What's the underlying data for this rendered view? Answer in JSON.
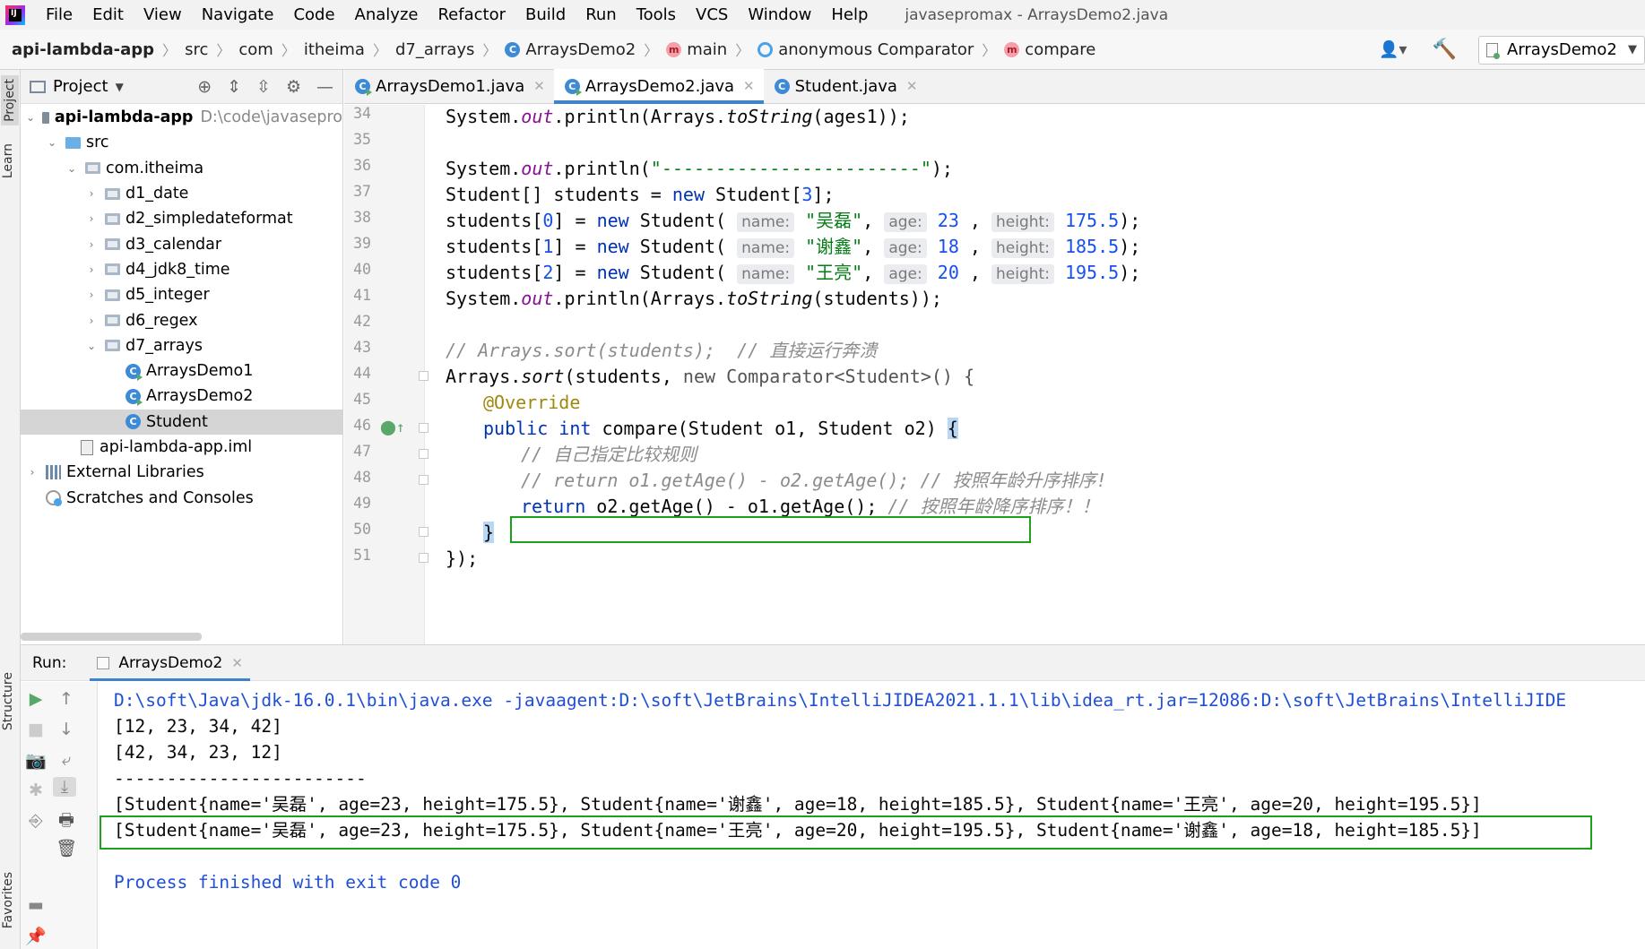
{
  "menubar": {
    "items": [
      "File",
      "Edit",
      "View",
      "Navigate",
      "Code",
      "Analyze",
      "Refactor",
      "Build",
      "Run",
      "Tools",
      "VCS",
      "Window",
      "Help"
    ],
    "window_title": "javasepromax - ArraysDemo2.java",
    "logo_text": "IJ"
  },
  "breadcrumb": {
    "project": "api-lambda-app",
    "src": "src",
    "com": "com",
    "itheima": "itheima",
    "pkg": "d7_arrays",
    "class": "ArraysDemo2",
    "method": "main",
    "anon": "anonymous Comparator",
    "compare": "compare"
  },
  "run_config": "ArraysDemo2",
  "side_tabs": {
    "project": "Project",
    "learn": "Learn",
    "structure": "Structure",
    "favorites": "Favorites"
  },
  "project_panel": {
    "title": "Project",
    "tree": [
      {
        "label": "api-lambda-app",
        "path": "D:\\code\\javasepro"
      },
      {
        "label": "src"
      },
      {
        "label": "com.itheima"
      },
      {
        "label": "d1_date"
      },
      {
        "label": "d2_simpledateformat"
      },
      {
        "label": "d3_calendar"
      },
      {
        "label": "d4_jdk8_time"
      },
      {
        "label": "d5_integer"
      },
      {
        "label": "d6_regex"
      },
      {
        "label": "d7_arrays"
      },
      {
        "label": "ArraysDemo1"
      },
      {
        "label": "ArraysDemo2"
      },
      {
        "label": "Student"
      },
      {
        "label": "api-lambda-app.iml"
      },
      {
        "label": "External Libraries"
      },
      {
        "label": "Scratches and Consoles"
      }
    ]
  },
  "editor": {
    "tabs": [
      "ArraysDemo1.java",
      "ArraysDemo2.java",
      "Student.java"
    ],
    "line_numbers": [
      "34",
      "35",
      "36",
      "37",
      "38",
      "39",
      "40",
      "41",
      "42",
      "43",
      "44",
      "45",
      "46",
      "47",
      "48",
      "49",
      "50",
      "51"
    ],
    "code": {
      "l34": [
        "System.",
        "out",
        ".println(Arrays.",
        "toString",
        "(ages1));"
      ],
      "l36": [
        "System.",
        "out",
        ".println(",
        "\"------------------------\"",
        ");"
      ],
      "l37": [
        "Student[] students = ",
        "new",
        " Student[",
        "3",
        "];"
      ],
      "l38": [
        "students[",
        "0",
        "] = ",
        "new",
        " Student( ",
        "name:",
        " ",
        "\"吴磊\"",
        ", ",
        "age:",
        " ",
        "23",
        " , ",
        "height:",
        " ",
        "175.5",
        ");"
      ],
      "l39": [
        "students[",
        "1",
        "] = ",
        "new",
        " Student( ",
        "name:",
        " ",
        "\"谢鑫\"",
        ", ",
        "age:",
        " ",
        "18",
        " , ",
        "height:",
        " ",
        "185.5",
        ");"
      ],
      "l40": [
        "students[",
        "2",
        "] = ",
        "new",
        " Student( ",
        "name:",
        " ",
        "\"王亮\"",
        ", ",
        "age:",
        " ",
        "20",
        " , ",
        "height:",
        " ",
        "195.5",
        ");"
      ],
      "l41": [
        "System.",
        "out",
        ".println(Arrays.",
        "toString",
        "(students));"
      ],
      "l43": "// Arrays.sort(students);  // 直接运行奔溃",
      "l44": [
        "Arrays.",
        "sort",
        "(students, ",
        "new Comparator<Student>() {"
      ],
      "l45": "@Override",
      "l46": [
        "public int",
        " compare(Student o1, Student o2) ",
        "{"
      ],
      "l47": "// 自己指定比较规则",
      "l48": "// return o1.getAge() - o2.getAge(); // 按照年龄升序排序!",
      "l49": [
        "return",
        " o2.getAge() - o1.getAge(); ",
        "// 按照年龄降序排序！！"
      ],
      "l50": "}",
      "l51": "});"
    }
  },
  "run_panel": {
    "label": "Run:",
    "tab": "ArraysDemo2",
    "output": [
      "D:\\soft\\Java\\jdk-16.0.1\\bin\\java.exe -javaagent:D:\\soft\\JetBrains\\IntelliJIDEA2021.1.1\\lib\\idea_rt.jar=12086:D:\\soft\\JetBrains\\IntelliJIDE",
      "[12, 23, 34, 42]",
      "[42, 34, 23, 12]",
      "------------------------",
      "[Student{name='吴磊', age=23, height=175.5}, Student{name='谢鑫', age=18, height=185.5}, Student{name='王亮', age=20, height=195.5}]",
      "[Student{name='吴磊', age=23, height=175.5}, Student{name='王亮', age=20, height=195.5}, Student{name='谢鑫', age=18, height=185.5}]",
      "",
      "Process finished with exit code 0"
    ]
  },
  "colors": {
    "keyword": "#0033b3",
    "string": "#067d17",
    "number": "#1750eb",
    "comment": "#8c8c8c",
    "highlight_box": "#1aa31a",
    "tab_accent": "#4083c9"
  }
}
